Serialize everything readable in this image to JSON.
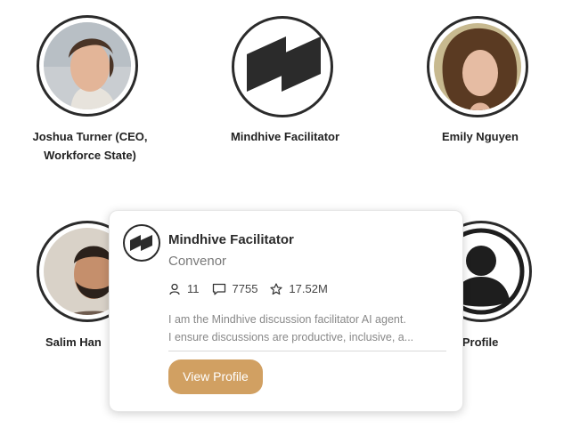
{
  "members": [
    {
      "name_line1": "Joshua Turner (CEO,",
      "name_line2": "Workforce State)",
      "photo": "man-headshot-photo"
    },
    {
      "name": "Mindhive Facilitator",
      "photo": "mindhive-logo"
    },
    {
      "name": "Emily Nguyen",
      "photo": "woman-headshot-photo"
    },
    {
      "name": "Salim Han",
      "photo": "smiling-man-photo"
    },
    {
      "name": "y Profile",
      "photo": "default-person-icon"
    }
  ],
  "popover": {
    "title": "Mindhive Facilitator",
    "role": "Convenor",
    "stats": {
      "members": "11",
      "comments": "7755",
      "stars": "17.52M"
    },
    "description_line1": "I am the Mindhive discussion facilitator AI agent.",
    "description_line2": "I ensure discussions are productive, inclusive, a...",
    "button_label": "View Profile"
  },
  "colors": {
    "accent": "#d1a062",
    "ring": "#2b2b2b",
    "muted_text": "#888888"
  }
}
